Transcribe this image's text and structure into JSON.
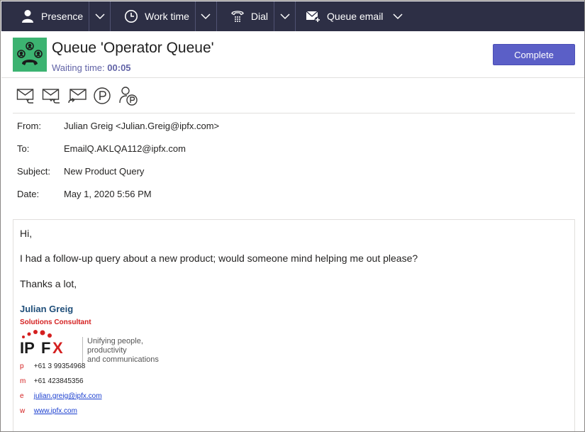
{
  "toolbar": {
    "presence_label": "Presence",
    "worktime_label": "Work time",
    "dial_label": "Dial",
    "queue_email_label": "Queue email"
  },
  "header": {
    "title": "Queue 'Operator Queue'",
    "waiting_label": "Waiting time:",
    "waiting_value": "00:05",
    "complete_label": "Complete",
    "accent": "#5b5fc7",
    "avatar_color": "#3cb371"
  },
  "actions": [
    "reply-icon",
    "reply-all-icon",
    "forward-icon",
    "park-icon",
    "park-user-icon"
  ],
  "meta": {
    "from_label": "From:",
    "from_value": "Julian Greig <Julian.Greig@ipfx.com>",
    "to_label": "To:",
    "to_value": "EmailQ.AKLQA112@ipfx.com",
    "subject_label": "Subject:",
    "subject_value": "New Product Query",
    "date_label": "Date:",
    "date_value": "May 1, 2020 5:56 PM"
  },
  "body": {
    "greeting": "Hi,",
    "line1": "I had a follow-up query about a new product; would someone mind helping me out please?",
    "line2": "Thanks a lot,"
  },
  "signature": {
    "name": "Julian Greig",
    "title": "Solutions Consultant",
    "logo_text_1": "IP",
    "logo_text_2": "F",
    "logo_text_3": "X",
    "tagline_1": "Unifying people, productivity",
    "tagline_2": "and communications",
    "phone_key": "p",
    "phone": "+61 3 99354968",
    "mobile_key": "m",
    "mobile": "+61 423845356",
    "email_key": "e",
    "email": "julian.greig@ipfx.com",
    "web_key": "w",
    "web": "www.ipfx.com"
  }
}
